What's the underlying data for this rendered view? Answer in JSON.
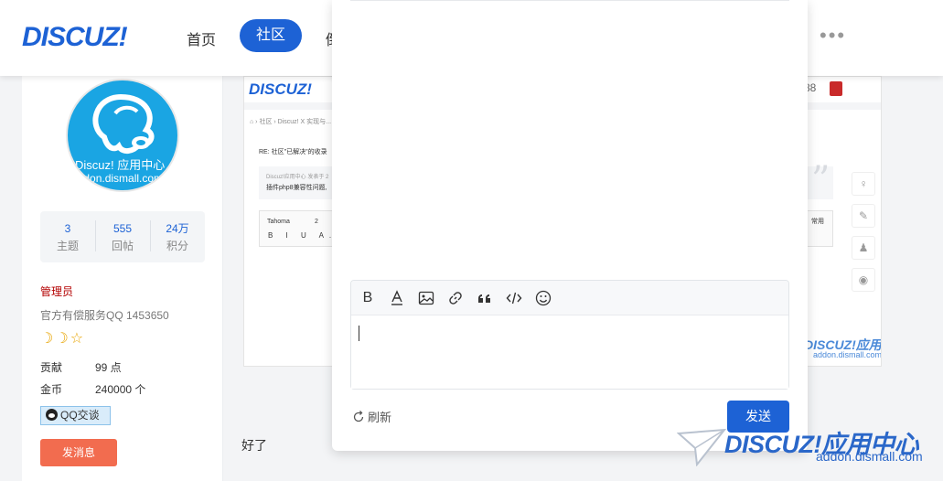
{
  "header": {
    "logo": "DISCUZ!",
    "nav": {
      "home": "首页",
      "community": "社区",
      "partial": "倒"
    },
    "more": "•••"
  },
  "profile": {
    "avatar": {
      "line1": "Discuz! 应用中心",
      "line2": "addon.dismall.com"
    },
    "stats": [
      {
        "value": "3",
        "label": "主题"
      },
      {
        "value": "555",
        "label": "回帖"
      },
      {
        "value": "24万",
        "label": "积分"
      }
    ],
    "role": "管理员",
    "description": "官方有偿服务QQ 1453650",
    "stars": "☽☽☆",
    "contribution": {
      "label": "贡献",
      "value": "99 点"
    },
    "gold": {
      "label": "金币",
      "value": "240000 个"
    },
    "qq_button": "QQ交谈",
    "message_button": "发消息"
  },
  "post_image": {
    "logo": "DISCUZ!",
    "top_right": "88",
    "breadcrumb": "⌂ › 社区 › Discuz! X 实现与...",
    "reply_title": "RE: 社区\"已解决\"的收录",
    "quote_meta": "Discuz!应用中心 发表于 2",
    "quote_text": "插件php8兼容性问题,",
    "quote_mark": "”",
    "font_name": "Tahoma",
    "font_size": "2",
    "toolbar": "B I U A.",
    "common": "常用",
    "side_icons": [
      "♀",
      "✎",
      "♟",
      "◉"
    ],
    "watermark1": "DISCUZ!应用中心",
    "watermark2": "addon.dismall.com"
  },
  "post_text": "好了",
  "modal": {
    "toolbar": [
      "bold-icon",
      "font-color-icon",
      "image-icon",
      "link-icon",
      "quote-icon",
      "code-icon",
      "emoji-icon"
    ],
    "bold_glyph": "B",
    "refresh_label": "刷新",
    "send_label": "发送"
  },
  "watermark": {
    "line1": "DISCUZ!应用中心",
    "line2": "addon.dismall.com"
  },
  "colors": {
    "brand": "#1d62d5",
    "role_red": "#b30000",
    "message_button": "#f26c4f"
  }
}
